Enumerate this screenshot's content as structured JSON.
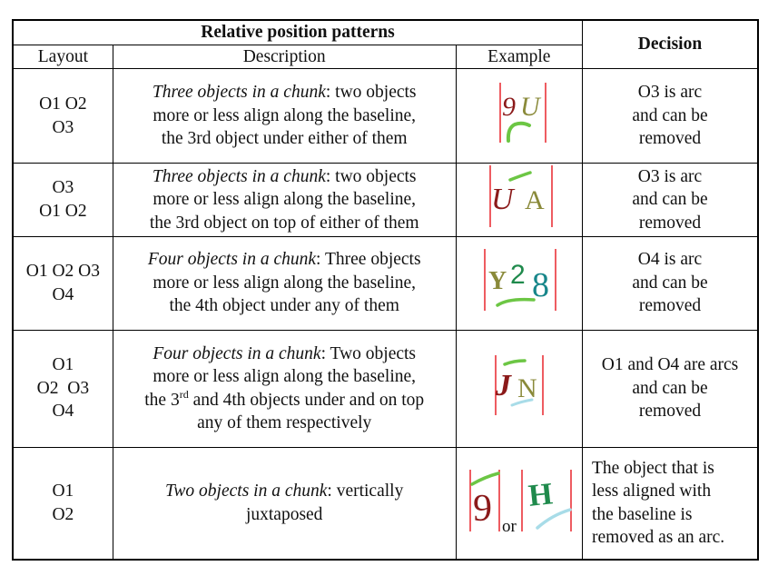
{
  "table": {
    "group_header": "Relative position patterns",
    "decision_header": "Decision",
    "columns": [
      "Layout",
      "Description",
      "Example"
    ],
    "rows": [
      {
        "layout": [
          "O1 O2",
          "O3"
        ],
        "description": {
          "italic": "Three objects in a chunk",
          "rest": ": two objects",
          "lines": [
            "more or less align along the baseline,",
            "the 3rd object under either of them"
          ]
        },
        "example": {
          "glyphs": [
            "9",
            "U"
          ],
          "arc": "under",
          "colors": [
            "#8b1a1a",
            "#8a8a3a"
          ],
          "arc_color": "#6cc644"
        },
        "decision": [
          "O3 is arc",
          "and can be",
          "removed"
        ]
      },
      {
        "layout": [
          "O3",
          "O1 O2"
        ],
        "description": {
          "italic": "Three objects in a chunk",
          "rest": ": two objects",
          "lines": [
            "more or less align along the baseline,",
            "the 3rd object on top of either of them"
          ]
        },
        "example": {
          "glyphs": [
            "U",
            "A"
          ],
          "arc": "top",
          "colors": [
            "#8b1a1a",
            "#8a8a3a"
          ],
          "arc_color": "#6cc644"
        },
        "decision": [
          "O3 is arc",
          "and can be",
          "removed"
        ]
      },
      {
        "layout": [
          "O1 O2 O3",
          "O4"
        ],
        "description": {
          "italic": "Four objects in a chunk",
          "rest": ": Three objects",
          "lines": [
            "more or less align along the baseline,",
            "the 4th object under any of them"
          ]
        },
        "example": {
          "glyphs": [
            "Y",
            "2",
            "8"
          ],
          "arc": "under",
          "colors": [
            "#8a8a3a",
            "#1f8a4c",
            "#17868a"
          ],
          "arc_color": "#6cc644"
        },
        "decision": [
          "O4 is arc",
          "and can be",
          "removed"
        ]
      },
      {
        "layout": [
          "O1",
          "O2  O3",
          "O4"
        ],
        "description": {
          "italic": "Four objects in a chunk",
          "rest": ": Two objects",
          "lines": [
            "more or less align along the baseline,"
          ],
          "line3_pre": "the 3",
          "line3_sup": "rd",
          "line3_post": " and 4th objects under and on top",
          "line4": "any of them respectively"
        },
        "example": {
          "glyphs": [
            "J",
            "N"
          ],
          "arc": "both",
          "colors": [
            "#8b1a1a",
            "#8a8a3a"
          ],
          "arc_color": "#6cc644",
          "arc2_color": "#a8dce8"
        },
        "decision": [
          "O1 and O4 are arcs",
          "and can be",
          "removed"
        ]
      },
      {
        "layout": [
          "O1",
          "O2"
        ],
        "description": {
          "italic": "Two objects in a chunk",
          "rest": ": vertically",
          "lines": [
            "juxtaposed"
          ]
        },
        "example": {
          "glyphs": [
            "9",
            "H"
          ],
          "connector": "or",
          "colors": [
            "#8b1a1a",
            "#1f8a4c"
          ],
          "arc_color": "#6cc644",
          "arc2_color": "#a8dce8"
        },
        "decision": [
          "The object that is",
          "less aligned with",
          "the baseline is",
          "removed as an arc."
        ]
      }
    ]
  },
  "colors": {
    "border": "#000000",
    "guide_line": "#e8262c"
  }
}
